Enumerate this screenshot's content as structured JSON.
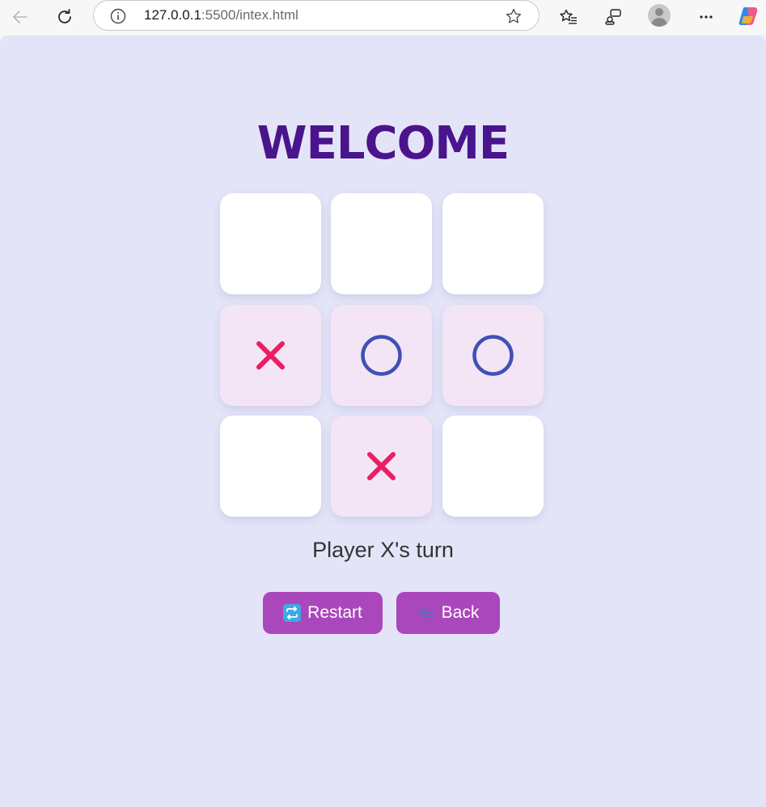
{
  "browser": {
    "url_host": "127.0.0.1",
    "url_rest": ":5500/intex.html"
  },
  "page": {
    "title": "WELCOME",
    "status": "Player X's turn",
    "board": [
      "",
      "",
      "",
      "X",
      "O",
      "O",
      "",
      "X",
      ""
    ],
    "colors": {
      "background": "#e4e4f8",
      "title": "#4a148c",
      "x_mark": "#e91e63",
      "o_mark": "#3f51b5",
      "filled_cell": "#f3e5f5",
      "button": "#ab47bc"
    },
    "buttons": {
      "restart_label": "Restart",
      "restart_icon": "repeat-icon",
      "back_label": "Back",
      "back_icon": "left-arrow-icon"
    }
  }
}
